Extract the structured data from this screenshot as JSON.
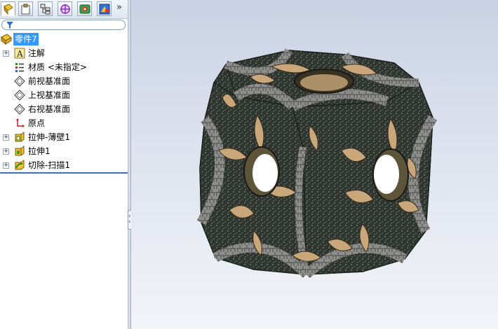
{
  "toolbar": {
    "tabs": [
      {
        "icon": "feature-manager-icon",
        "active": true
      },
      {
        "icon": "property-manager-icon",
        "active": false
      },
      {
        "icon": "configuration-manager-icon",
        "active": false
      },
      {
        "icon": "dimxpert-manager-icon",
        "active": false
      },
      {
        "icon": "display-manager-icon",
        "active": false
      },
      {
        "icon": "cam-manager-icon",
        "active": false
      }
    ],
    "more": "»"
  },
  "filter": {
    "icon": "filter-icon"
  },
  "tree": {
    "root": {
      "label": "零件7",
      "icon": "part-icon"
    },
    "items": [
      {
        "label": "注解",
        "icon": "annotations-icon",
        "expandable": true
      },
      {
        "label": "材质 <未指定>",
        "icon": "material-icon",
        "expandable": false
      },
      {
        "label": "前视基准面",
        "icon": "plane-icon",
        "expandable": false
      },
      {
        "label": "上视基准面",
        "icon": "plane-icon",
        "expandable": false
      },
      {
        "label": "右视基准面",
        "icon": "plane-icon",
        "expandable": false
      },
      {
        "label": "原点",
        "icon": "origin-icon",
        "expandable": false
      },
      {
        "label": "拉伸-薄壁1",
        "icon": "extrude-thin-icon",
        "expandable": true
      },
      {
        "label": "拉伸1",
        "icon": "extrude-icon",
        "expandable": true
      },
      {
        "label": "切除-扫描1",
        "icon": "cut-sweep-icon",
        "expandable": true
      }
    ]
  },
  "colors": {
    "selection": "#3399ff",
    "tile_dark": "#2e342e",
    "tile_stone": "#8e8f8c",
    "tile_tan": "#c9a77a"
  }
}
